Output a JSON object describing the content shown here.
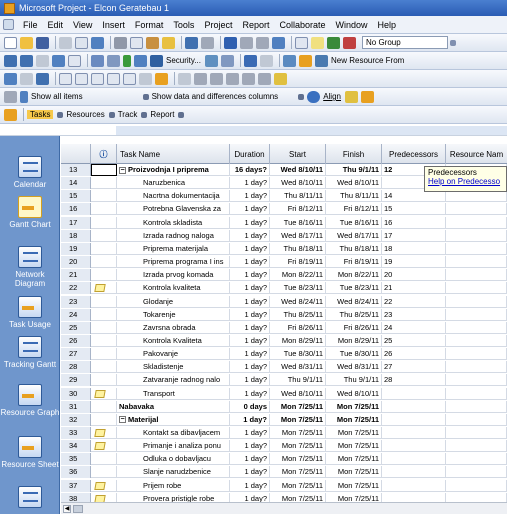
{
  "window": {
    "title": "Microsoft Project - Elcon Geratebau 1"
  },
  "menu": [
    {
      "id": "file",
      "label": "File"
    },
    {
      "id": "edit",
      "label": "Edit"
    },
    {
      "id": "view",
      "label": "View"
    },
    {
      "id": "insert",
      "label": "Insert"
    },
    {
      "id": "format",
      "label": "Format"
    },
    {
      "id": "tools",
      "label": "Tools"
    },
    {
      "id": "project",
      "label": "Project"
    },
    {
      "id": "report",
      "label": "Report"
    },
    {
      "id": "collaborate",
      "label": "Collaborate"
    },
    {
      "id": "window",
      "label": "Window"
    },
    {
      "id": "help",
      "label": "Help"
    }
  ],
  "toolbar1": {
    "group_label": "No Group"
  },
  "toolbar2": {
    "security_label": "Security...",
    "new_resource_label": "New Resource From"
  },
  "filterbar": {
    "show_label": "Show all items",
    "compare_label": "Show data and differences columns",
    "align_label": "Align"
  },
  "guidebar": {
    "tasks": "Tasks",
    "resources": "Resources",
    "track": "Track",
    "report": "Report"
  },
  "sidebar": [
    {
      "label": "Calendar"
    },
    {
      "label": "Gantt Chart"
    },
    {
      "label": "Network Diagram"
    },
    {
      "label": "Task Usage"
    },
    {
      "label": "Tracking Gantt"
    },
    {
      "label": "Resource Graph"
    },
    {
      "label": "Resource Sheet"
    }
  ],
  "columns": [
    {
      "label": ""
    },
    {
      "label": "ⓘ"
    },
    {
      "label": "Task Name"
    },
    {
      "label": "Duration"
    },
    {
      "label": "Start"
    },
    {
      "label": "Finish"
    },
    {
      "label": "Predecessors"
    },
    {
      "label": "Resource Nam"
    }
  ],
  "tooltip": {
    "title": "Predecessors",
    "link": "Help on Predecesso"
  },
  "rows": [
    {
      "id": "13",
      "note": false,
      "name": "Proizvodnja I pripremа",
      "duration": "16 days?",
      "start": "Wed 8/10/11",
      "finish": "Thu 9/1/11",
      "pred": "12",
      "bold": true,
      "expand": "−",
      "indent": 0
    },
    {
      "id": "14",
      "note": false,
      "name": "Naruzbenica",
      "duration": "1 day?",
      "start": "Wed 8/10/11",
      "finish": "Wed 8/10/11",
      "pred": "",
      "bold": false,
      "expand": "",
      "indent": 1
    },
    {
      "id": "15",
      "note": false,
      "name": "Nacrtna dokumentacija",
      "duration": "1 day?",
      "start": "Thu 8/11/11",
      "finish": "Thu 8/11/11",
      "pred": "14",
      "bold": false,
      "expand": "",
      "indent": 1
    },
    {
      "id": "16",
      "note": false,
      "name": "Potrebna Glavenska za",
      "duration": "1 day?",
      "start": "Fri 8/12/11",
      "finish": "Fri 8/12/11",
      "pred": "15",
      "bold": false,
      "expand": "",
      "indent": 1
    },
    {
      "id": "17",
      "note": false,
      "name": "Kontrola skladista",
      "duration": "1 day?",
      "start": "Tue 8/16/11",
      "finish": "Tue 8/16/11",
      "pred": "16",
      "bold": false,
      "expand": "",
      "indent": 1
    },
    {
      "id": "18",
      "note": false,
      "name": "Izrada radnog naloga",
      "duration": "1 day?",
      "start": "Wed 8/17/11",
      "finish": "Wed 8/17/11",
      "pred": "17",
      "bold": false,
      "expand": "",
      "indent": 1
    },
    {
      "id": "19",
      "note": false,
      "name": "Priprema materijala",
      "duration": "1 day?",
      "start": "Thu 8/18/11",
      "finish": "Thu 8/18/11",
      "pred": "18",
      "bold": false,
      "expand": "",
      "indent": 1
    },
    {
      "id": "20",
      "note": false,
      "name": "Priprema programa I ins",
      "duration": "1 day?",
      "start": "Fri 8/19/11",
      "finish": "Fri 8/19/11",
      "pred": "19",
      "bold": false,
      "expand": "",
      "indent": 1
    },
    {
      "id": "21",
      "note": false,
      "name": "Izrada prvog komada",
      "duration": "1 day?",
      "start": "Mon 8/22/11",
      "finish": "Mon 8/22/11",
      "pred": "20",
      "bold": false,
      "expand": "",
      "indent": 1
    },
    {
      "id": "22",
      "note": true,
      "name": "Kontrola kvaliteta",
      "duration": "1 day?",
      "start": "Tue 8/23/11",
      "finish": "Tue 8/23/11",
      "pred": "21",
      "bold": false,
      "expand": "",
      "indent": 1
    },
    {
      "id": "23",
      "note": false,
      "name": "Glodanje",
      "duration": "1 day?",
      "start": "Wed 8/24/11",
      "finish": "Wed 8/24/11",
      "pred": "22",
      "bold": false,
      "expand": "",
      "indent": 1
    },
    {
      "id": "24",
      "note": false,
      "name": "Tokarenje",
      "duration": "1 day?",
      "start": "Thu 8/25/11",
      "finish": "Thu 8/25/11",
      "pred": "23",
      "bold": false,
      "expand": "",
      "indent": 1
    },
    {
      "id": "25",
      "note": false,
      "name": "Zavrsna obrada",
      "duration": "1 day?",
      "start": "Fri 8/26/11",
      "finish": "Fri 8/26/11",
      "pred": "24",
      "bold": false,
      "expand": "",
      "indent": 1
    },
    {
      "id": "26",
      "note": false,
      "name": "Kontrola Kvaliteta",
      "duration": "1 day?",
      "start": "Mon 8/29/11",
      "finish": "Mon 8/29/11",
      "pred": "25",
      "bold": false,
      "expand": "",
      "indent": 1
    },
    {
      "id": "27",
      "note": false,
      "name": "Pakovanje",
      "duration": "1 day?",
      "start": "Tue 8/30/11",
      "finish": "Tue 8/30/11",
      "pred": "26",
      "bold": false,
      "expand": "",
      "indent": 1
    },
    {
      "id": "28",
      "note": false,
      "name": "Skladistenje",
      "duration": "1 day?",
      "start": "Wed 8/31/11",
      "finish": "Wed 8/31/11",
      "pred": "27",
      "bold": false,
      "expand": "",
      "indent": 1
    },
    {
      "id": "29",
      "note": false,
      "name": "Zatvaranje radnog nalo",
      "duration": "1 day?",
      "start": "Thu 9/1/11",
      "finish": "Thu 9/1/11",
      "pred": "28",
      "bold": false,
      "expand": "",
      "indent": 1
    },
    {
      "id": "30",
      "note": true,
      "name": "Transport",
      "duration": "1 day?",
      "start": "Wed 8/10/11",
      "finish": "Wed 8/10/11",
      "pred": "",
      "bold": false,
      "expand": "",
      "indent": 1
    },
    {
      "id": "31",
      "note": false,
      "name": "Nabavaka",
      "duration": "0 days",
      "start": "Mon 7/25/11",
      "finish": "Mon 7/25/11",
      "pred": "",
      "bold": true,
      "expand": "",
      "indent": 0
    },
    {
      "id": "32",
      "note": false,
      "name": "Materijal",
      "duration": "1 day?",
      "start": "Mon 7/25/11",
      "finish": "Mon 7/25/11",
      "pred": "",
      "bold": true,
      "expand": "−",
      "indent": 0
    },
    {
      "id": "33",
      "note": true,
      "name": "Kontakt sa dibavljacem",
      "duration": "1 day?",
      "start": "Mon 7/25/11",
      "finish": "Mon 7/25/11",
      "pred": "",
      "bold": false,
      "expand": "",
      "indent": 1
    },
    {
      "id": "34",
      "note": true,
      "name": "Primanje i analiza ponu",
      "duration": "1 day?",
      "start": "Mon 7/25/11",
      "finish": "Mon 7/25/11",
      "pred": "",
      "bold": false,
      "expand": "",
      "indent": 1
    },
    {
      "id": "35",
      "note": false,
      "name": "Odluka o dobavljacu",
      "duration": "1 day?",
      "start": "Mon 7/25/11",
      "finish": "Mon 7/25/11",
      "pred": "",
      "bold": false,
      "expand": "",
      "indent": 1
    },
    {
      "id": "36",
      "note": false,
      "name": "Slanje narudzbenice",
      "duration": "1 day?",
      "start": "Mon 7/25/11",
      "finish": "Mon 7/25/11",
      "pred": "",
      "bold": false,
      "expand": "",
      "indent": 1
    },
    {
      "id": "37",
      "note": true,
      "name": "Prijem robe",
      "duration": "1 day?",
      "start": "Mon 7/25/11",
      "finish": "Mon 7/25/11",
      "pred": "",
      "bold": false,
      "expand": "",
      "indent": 1
    },
    {
      "id": "38",
      "note": true,
      "name": "Provera pristigle robe",
      "duration": "1 day?",
      "start": "Mon 7/25/11",
      "finish": "Mon 7/25/11",
      "pred": "",
      "bold": false,
      "expand": "",
      "indent": 1
    }
  ]
}
